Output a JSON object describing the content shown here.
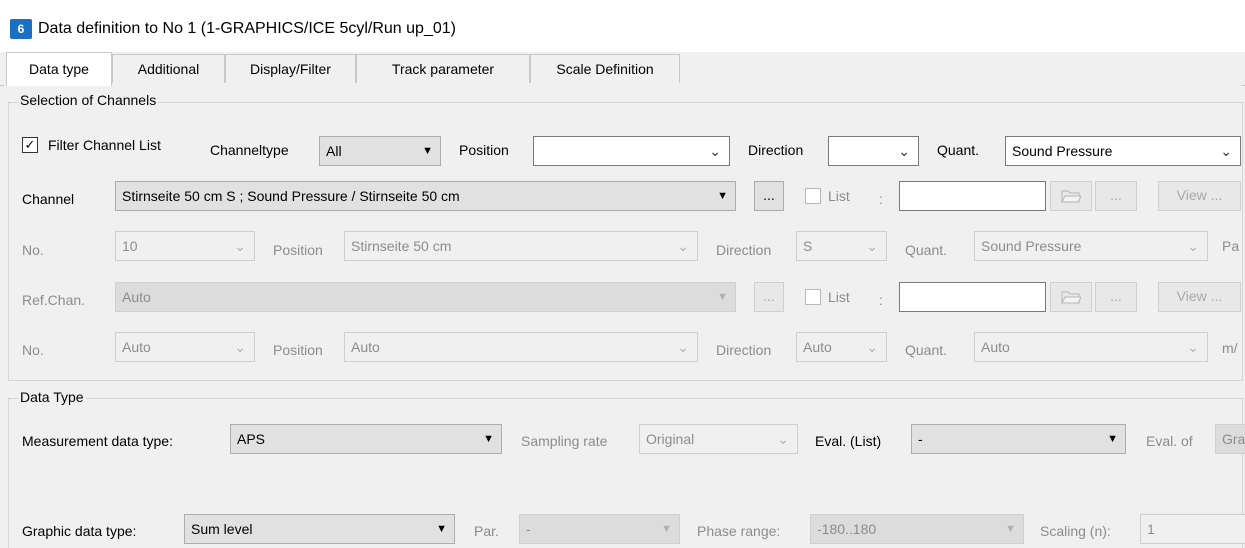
{
  "window": {
    "icon_text": "6",
    "title": "Data definition to No 1 (1-GRAPHICS/ICE 5cyl/Run up_01)"
  },
  "tabs": [
    "Data type",
    "Additional",
    "Display/Filter",
    "Track parameter",
    "Scale Definition"
  ],
  "channels": {
    "group_title": "Selection of Channels",
    "filter_label": "Filter Channel List",
    "filter_checked": "✓",
    "channeltype_label": "Channeltype",
    "channeltype_value": "All",
    "position_label": "Position",
    "position_value": "",
    "direction_label": "Direction",
    "direction_value": "",
    "quant_label": "Quant.",
    "quant_value": "Sound Pressure",
    "channel_label": "Channel",
    "channel_value": "Stirnseite 50 cm S ; Sound Pressure / Stirnseite 50 cm",
    "ellipsis": "...",
    "list_label": "List",
    "colon": ":",
    "list_value": "",
    "view_label": "View ...",
    "no_label": "No.",
    "no_value": "10",
    "row3_position_value": "Stirnseite 50 cm",
    "row3_direction_value": "S",
    "row3_quant_value": "Sound Pressure",
    "row3_unit": "Pa",
    "refchan_label": "Ref.Chan.",
    "refchan_value": "Auto",
    "ref_no_value": "Auto",
    "ref_position_value": "Auto",
    "ref_direction_value": "Auto",
    "ref_quant_value": "Auto",
    "ref_unit": "m/"
  },
  "datatype": {
    "group_title": "Data Type",
    "measurement_label": "Measurement data type:",
    "measurement_value": "APS",
    "sampling_label": "Sampling rate",
    "sampling_value": "Original",
    "eval_list_label": "Eval. (List)",
    "eval_list_value": "-",
    "eval_of_label": "Eval. of",
    "eval_of_value": "Gra",
    "graphic_label": "Graphic data type:",
    "graphic_value": "Sum level",
    "par_label": "Par.",
    "par_value": "-",
    "phase_label": "Phase range:",
    "phase_value": "-180..180",
    "scaling_label": "Scaling (n):",
    "scaling_value": "1"
  }
}
